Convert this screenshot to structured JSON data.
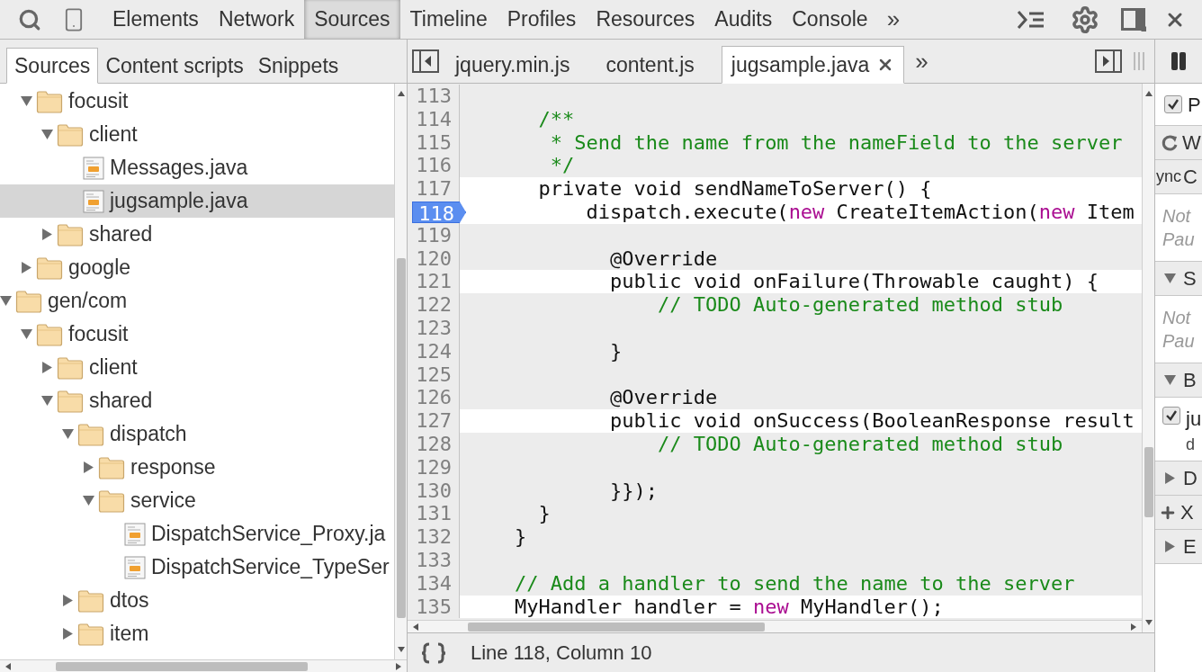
{
  "toolbar": {
    "tabs": [
      {
        "label": "Elements",
        "selected": false
      },
      {
        "label": "Network",
        "selected": false
      },
      {
        "label": "Sources",
        "selected": true
      },
      {
        "label": "Timeline",
        "selected": false
      },
      {
        "label": "Profiles",
        "selected": false
      },
      {
        "label": "Resources",
        "selected": false
      },
      {
        "label": "Audits",
        "selected": false
      },
      {
        "label": "Console",
        "selected": false
      }
    ],
    "more": "»"
  },
  "sidebar": {
    "tabs": [
      {
        "label": "Sources",
        "selected": true
      },
      {
        "label": "Content scripts",
        "selected": false
      },
      {
        "label": "Snippets",
        "selected": false
      }
    ],
    "tree": [
      {
        "children": [
          {
            "kind": "folder",
            "label": "focusit",
            "expanded": true,
            "selected": false,
            "children": [
              {
                "kind": "folder",
                "label": "client",
                "expanded": true,
                "selected": false,
                "children": [
                  {
                    "kind": "file",
                    "label": "Messages.java",
                    "selected": false
                  },
                  {
                    "kind": "file",
                    "label": "jugsample.java",
                    "selected": true
                  }
                ]
              },
              {
                "kind": "folder",
                "label": "shared",
                "expanded": false,
                "selected": false
              }
            ]
          },
          {
            "kind": "folder",
            "label": "google",
            "expanded": false,
            "selected": false
          }
        ]
      },
      {
        "kind": "folder",
        "label": "gen/com",
        "expanded": true,
        "selected": false,
        "children": [
          {
            "kind": "folder",
            "label": "focusit",
            "expanded": true,
            "selected": false,
            "children": [
              {
                "kind": "folder",
                "label": "client",
                "expanded": false,
                "selected": false
              },
              {
                "kind": "folder",
                "label": "shared",
                "expanded": true,
                "selected": false,
                "children": [
                  {
                    "kind": "folder",
                    "label": "dispatch",
                    "expanded": true,
                    "selected": false,
                    "children": [
                      {
                        "kind": "folder",
                        "label": "response",
                        "expanded": false,
                        "selected": false
                      },
                      {
                        "kind": "folder",
                        "label": "service",
                        "expanded": true,
                        "selected": false,
                        "children": [
                          {
                            "kind": "file",
                            "label": "DispatchService_Proxy.ja",
                            "selected": false
                          },
                          {
                            "kind": "file",
                            "label": "DispatchService_TypeSer",
                            "selected": false
                          }
                        ]
                      }
                    ]
                  },
                  {
                    "kind": "folder",
                    "label": "dtos",
                    "expanded": false,
                    "selected": false
                  },
                  {
                    "kind": "folder",
                    "label": "item",
                    "expanded": false,
                    "selected": false
                  }
                ]
              }
            ]
          }
        ]
      }
    ]
  },
  "editor": {
    "tabs": [
      {
        "label": "jquery.min.js",
        "selected": false
      },
      {
        "label": "content.js",
        "selected": false
      },
      {
        "label": "jugsample.java",
        "selected": true
      }
    ],
    "more": "»",
    "lines": [
      {
        "number": "113",
        "highlighted": false,
        "breakpoint": false
      },
      {
        "number": "114",
        "highlighted": false,
        "breakpoint": false,
        "segments": [
          {
            "kind": "comment",
            "text": "      /**"
          }
        ]
      },
      {
        "number": "115",
        "highlighted": false,
        "breakpoint": false,
        "segments": [
          {
            "kind": "comment",
            "text": "       * Send the name from the nameField to the server"
          }
        ]
      },
      {
        "number": "116",
        "highlighted": false,
        "breakpoint": false,
        "segments": [
          {
            "kind": "comment",
            "text": "       */"
          }
        ]
      },
      {
        "number": "117",
        "highlighted": true,
        "breakpoint": false,
        "segments": [
          {
            "kind": "plain",
            "text": "      private void sendNameToServer() {"
          }
        ]
      },
      {
        "number": "118",
        "highlighted": true,
        "breakpoint": true,
        "segments": [
          {
            "kind": "plain",
            "text": "          dispatch.execute("
          },
          {
            "kind": "keyword",
            "text": "new"
          },
          {
            "kind": "plain",
            "text": " CreateItemAction("
          },
          {
            "kind": "keyword",
            "text": "new"
          },
          {
            "kind": "plain",
            "text": " Item"
          }
        ]
      },
      {
        "number": "119",
        "highlighted": false,
        "breakpoint": false
      },
      {
        "number": "120",
        "highlighted": false,
        "breakpoint": false,
        "segments": [
          {
            "kind": "plain",
            "text": "            @Override"
          }
        ]
      },
      {
        "number": "121",
        "highlighted": true,
        "breakpoint": false,
        "segments": [
          {
            "kind": "plain",
            "text": "            public void onFailure(Throwable caught) {"
          }
        ]
      },
      {
        "number": "122",
        "highlighted": false,
        "breakpoint": false,
        "segments": [
          {
            "kind": "comment",
            "text": "                // TODO Auto-generated method stub"
          }
        ]
      },
      {
        "number": "123",
        "highlighted": false,
        "breakpoint": false
      },
      {
        "number": "124",
        "highlighted": false,
        "breakpoint": false,
        "segments": [
          {
            "kind": "plain",
            "text": "            }"
          }
        ]
      },
      {
        "number": "125",
        "highlighted": false,
        "breakpoint": false
      },
      {
        "number": "126",
        "highlighted": false,
        "breakpoint": false,
        "segments": [
          {
            "kind": "plain",
            "text": "            @Override"
          }
        ]
      },
      {
        "number": "127",
        "highlighted": true,
        "breakpoint": false,
        "segments": [
          {
            "kind": "plain",
            "text": "            public void onSuccess(BooleanResponse result"
          }
        ]
      },
      {
        "number": "128",
        "highlighted": false,
        "breakpoint": false,
        "segments": [
          {
            "kind": "comment",
            "text": "                // TODO Auto-generated method stub"
          }
        ]
      },
      {
        "number": "129",
        "highlighted": false,
        "breakpoint": false
      },
      {
        "number": "130",
        "highlighted": false,
        "breakpoint": false,
        "segments": [
          {
            "kind": "plain",
            "text": "            }});"
          }
        ]
      },
      {
        "number": "131",
        "highlighted": false,
        "breakpoint": false,
        "segments": [
          {
            "kind": "plain",
            "text": "      }"
          }
        ]
      },
      {
        "number": "132",
        "highlighted": false,
        "breakpoint": false,
        "segments": [
          {
            "kind": "plain",
            "text": "    }"
          }
        ]
      },
      {
        "number": "133",
        "highlighted": false,
        "breakpoint": false
      },
      {
        "number": "134",
        "highlighted": false,
        "breakpoint": false,
        "segments": [
          {
            "kind": "comment",
            "text": "    // Add a handler to send the name to the server"
          }
        ]
      },
      {
        "number": "135",
        "highlighted": true,
        "breakpoint": false,
        "segments": [
          {
            "kind": "plain",
            "text": "    MyHandler handler = "
          },
          {
            "kind": "keyword",
            "text": "new"
          },
          {
            "kind": "plain",
            "text": " MyHandler();"
          }
        ]
      }
    ],
    "status": "Line 118, Column 10"
  },
  "debugger_pane": {
    "sections": [
      {
        "kind": "checkbox",
        "label": "P",
        "checked": true
      },
      {
        "kind": "refresh",
        "label": "W"
      },
      {
        "kind": "async",
        "prefix": "ync",
        "label": "C"
      },
      {
        "kind": "message",
        "lines": [
          "Not",
          "Pau"
        ]
      },
      {
        "kind": "header",
        "label": "S",
        "expanded": true
      },
      {
        "kind": "message",
        "lines": [
          "Not",
          "Pau"
        ]
      },
      {
        "kind": "header",
        "label": "B",
        "expanded": true
      },
      {
        "kind": "breakpoint",
        "label": "ju",
        "detail": "d",
        "checked": true
      },
      {
        "kind": "header",
        "label": "D",
        "expanded": false
      },
      {
        "kind": "add",
        "label": "X"
      },
      {
        "kind": "header",
        "label": "E",
        "expanded": false
      }
    ]
  }
}
